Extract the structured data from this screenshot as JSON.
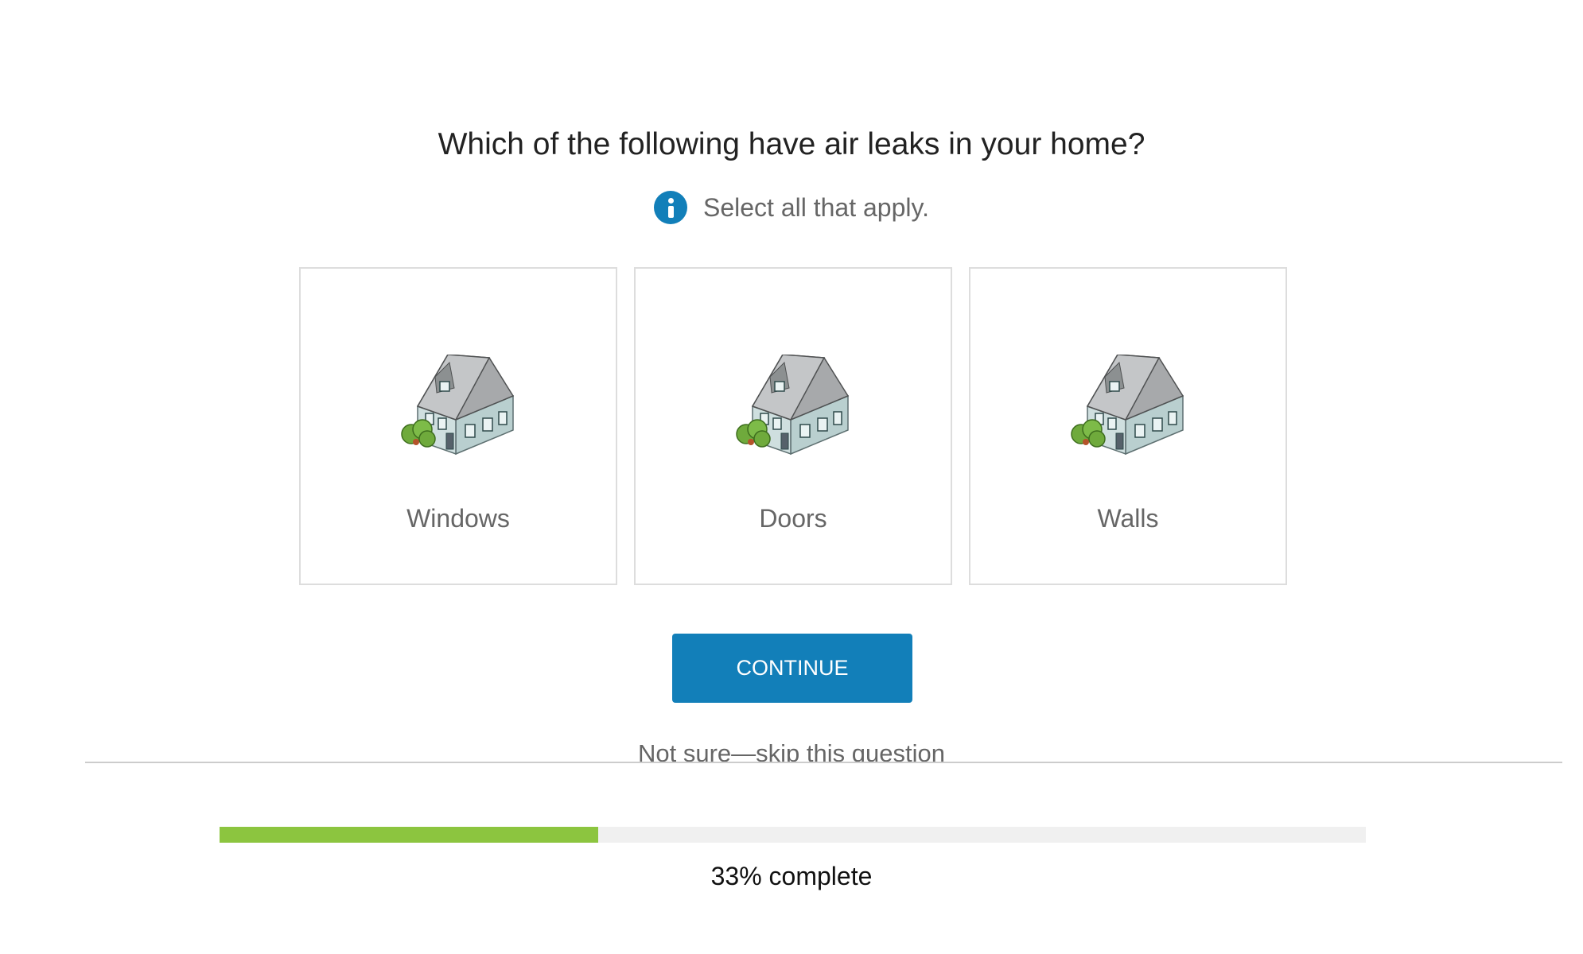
{
  "question": {
    "title": "Which of the following have air leaks in your home?",
    "hint": "Select all that apply.",
    "hint_icon": "info-icon"
  },
  "options": [
    {
      "label": "Windows",
      "icon": "house-icon"
    },
    {
      "label": "Doors",
      "icon": "house-icon"
    },
    {
      "label": "Walls",
      "icon": "house-icon"
    }
  ],
  "actions": {
    "continue_label": "CONTINUE",
    "skip_label": "Not sure—skip this question"
  },
  "progress": {
    "fraction": 0.33,
    "label": "33% complete"
  },
  "colors": {
    "accent": "#127fb9",
    "progress_fill": "#8cc53f",
    "progress_track": "#f0f0f0"
  }
}
